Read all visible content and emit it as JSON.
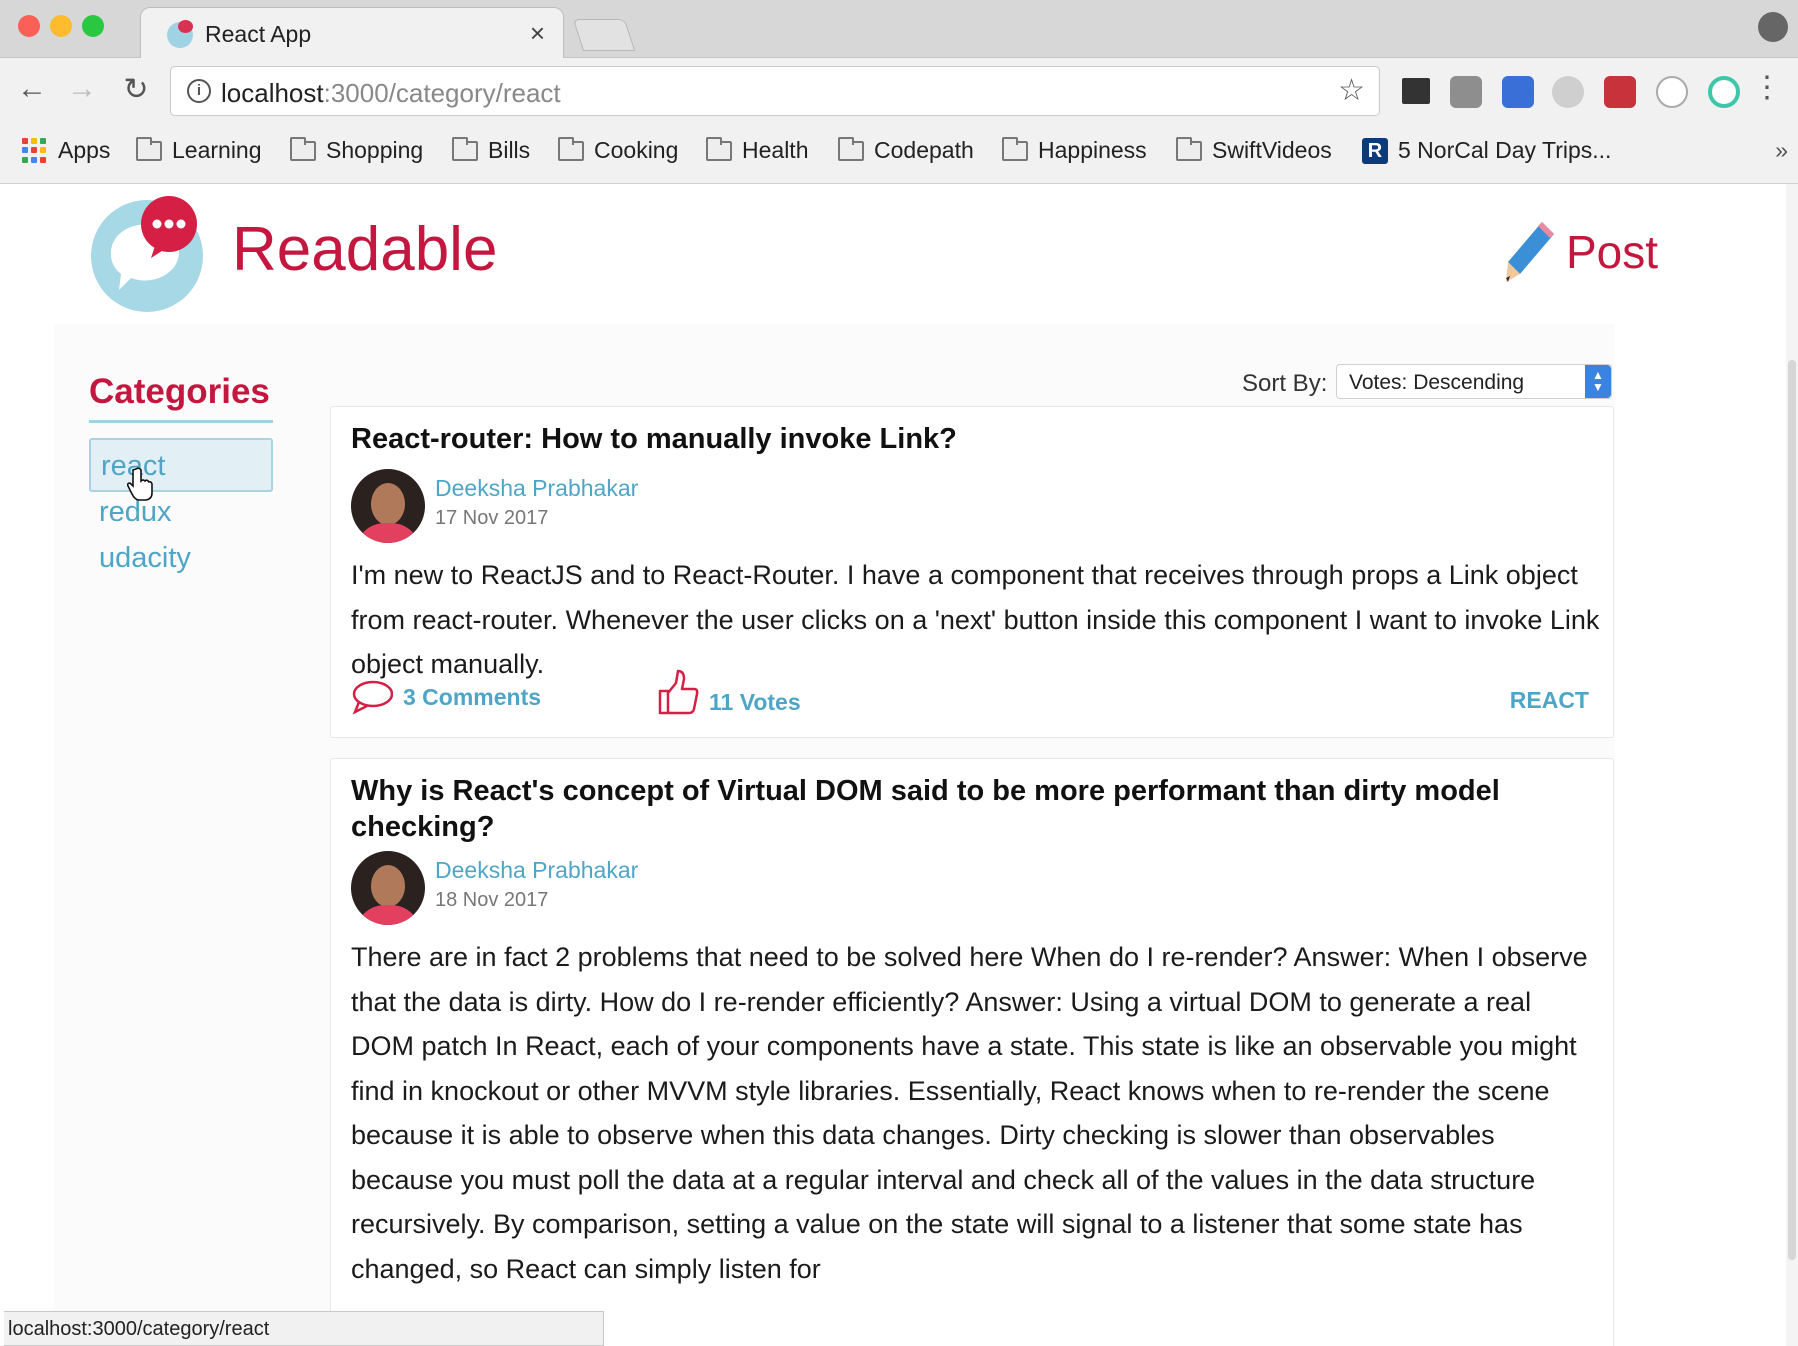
{
  "browser": {
    "tab_title": "React App",
    "tab_close": "×",
    "url_host": "localhost",
    "url_path": ":3000/category/react",
    "bookmarks": [
      {
        "label": "Apps",
        "icon": "apps-grid-icon"
      },
      {
        "label": "Learning",
        "icon": "folder-icon"
      },
      {
        "label": "Shopping",
        "icon": "folder-icon"
      },
      {
        "label": "Bills",
        "icon": "folder-icon"
      },
      {
        "label": "Cooking",
        "icon": "folder-icon"
      },
      {
        "label": "Health",
        "icon": "folder-icon"
      },
      {
        "label": "Codepath",
        "icon": "folder-icon"
      },
      {
        "label": "Happiness",
        "icon": "folder-icon"
      },
      {
        "label": "SwiftVideos",
        "icon": "folder-icon"
      },
      {
        "label": "5 NorCal Day Trips...",
        "icon": "r-site-icon"
      }
    ],
    "bookmarks_more": "»",
    "status_url": "localhost:3000/category/react"
  },
  "app": {
    "brand": "Readable",
    "post_button": "Post",
    "categories_title": "Categories",
    "categories": [
      {
        "label": "react",
        "active": true
      },
      {
        "label": "redux",
        "active": false
      },
      {
        "label": "udacity",
        "active": false
      }
    ],
    "sort_label": "Sort By:",
    "sort_value": "Votes: Descending",
    "posts": [
      {
        "title": "React-router: How to manually invoke Link?",
        "author": "Deeksha Prabhakar",
        "date": "17 Nov 2017",
        "body": "I'm new to ReactJS and to React-Router. I have a component that receives through props a Link object from react-router. Whenever the user clicks on a 'next' button inside this component I want to invoke Link object manually.",
        "comments": "3 Comments",
        "votes": "11 Votes",
        "category": "REACT"
      },
      {
        "title": "Why is React's concept of Virtual DOM said to be more performant than dirty model checking?",
        "author": "Deeksha Prabhakar",
        "date": "18 Nov 2017",
        "body": "There are in fact 2 problems that need to be solved here When do I re-render? Answer: When I observe that the data is dirty. How do I re-render efficiently? Answer: Using a virtual DOM to generate a real DOM patch In React, each of your components have a state. This state is like an observable you might find in knockout or other MVVM style libraries. Essentially, React knows when to re-render the scene because it is able to observe when this data changes. Dirty checking is slower than observables because you must poll the data at a regular interval and check all of the values in the data structure recursively. By comparison, setting a value on the state will signal to a listener that some state has changed, so React can simply listen for"
      }
    ]
  },
  "colors": {
    "brand": "#c3173f",
    "link": "#4fa5c6",
    "accent_light": "#9fd3e3"
  }
}
